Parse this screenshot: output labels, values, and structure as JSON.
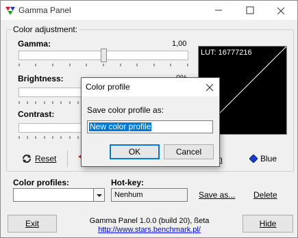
{
  "window": {
    "title": "Gamma Panel",
    "minimize_icon": "minimize-icon",
    "maximize_icon": "maximize-icon",
    "close_icon": "close-icon"
  },
  "adjustment": {
    "group_label": "Color adjustment:",
    "gamma": {
      "label": "Gamma:",
      "value": "1,00",
      "level": 0.5
    },
    "brightness": {
      "label": "Brightness:",
      "value": "0%",
      "level": 0.5
    },
    "contrast": {
      "label": "Contrast:",
      "level": 0.5
    },
    "lut_label": "LUT: 16777216"
  },
  "toolbar": {
    "reset_label": "Reset",
    "green_label_partial": "n",
    "blue_label": "Blue"
  },
  "profiles": {
    "label": "Color profiles:",
    "selected": "",
    "hotkey_label": "Hot-key:",
    "hotkey_value": "Nenhum",
    "save_as_label": "Save as...",
    "delete_label": "Delete"
  },
  "footer": {
    "exit_label": "Exit",
    "hide_label": "Hide",
    "version": "Gamma Panel 1.0.0 (build 20), ßeta",
    "url": "http://www.stars.benchmark.pl/"
  },
  "dialog": {
    "title": "Color profile",
    "prompt": "Save color profile as:",
    "input_value": "New color profile",
    "ok_label": "OK",
    "cancel_label": "Cancel"
  },
  "colors": {
    "selection": "#0078d7",
    "link": "#0000ee",
    "blue_icon": "#1a3fd0"
  }
}
